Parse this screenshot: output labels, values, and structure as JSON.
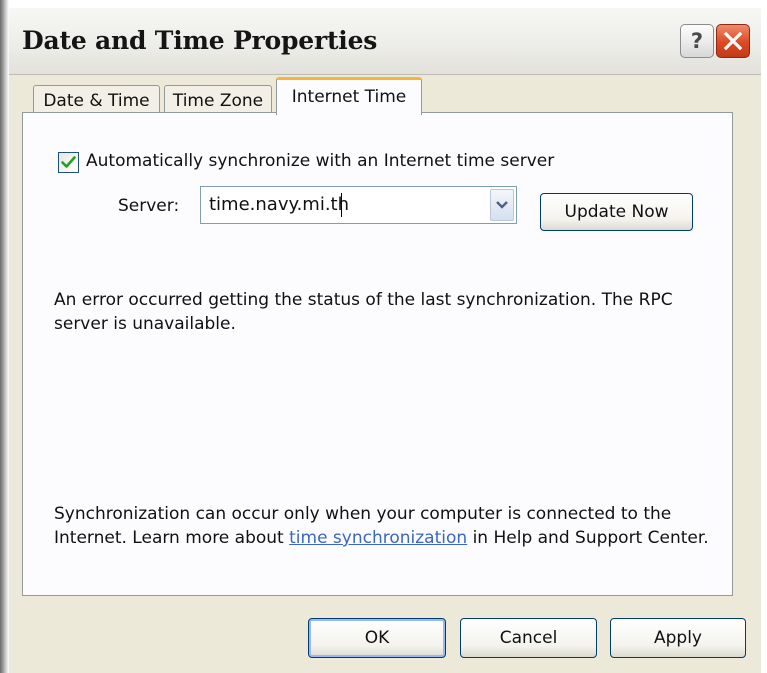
{
  "window": {
    "title": "Date and Time Properties",
    "help_glyph": "?",
    "help_icon": "question-mark-icon",
    "close_icon": "close-x-icon"
  },
  "tabs": [
    {
      "label": "Date & Time",
      "active": false
    },
    {
      "label": "Time Zone",
      "active": false
    },
    {
      "label": "Internet Time",
      "active": true
    }
  ],
  "sync": {
    "checkbox_label": "Automatically synchronize with an Internet time server",
    "checked": true,
    "server_label": "Server:",
    "server_value": "time.navy.mi.th",
    "update_button": "Update Now"
  },
  "status_message": "An error occurred getting the status of the last synchronization.  The RPC server is unavailable.",
  "info": {
    "text_before": "Synchronization can occur only when your computer is connected to the Internet.  Learn more about ",
    "link_text": "time synchronization",
    "text_after": " in Help and Support Center."
  },
  "buttons": {
    "ok": "OK",
    "cancel": "Cancel",
    "apply": "Apply"
  },
  "colors": {
    "dialog_bg": "#ECE9D8",
    "panel_bg": "#FCFCFE",
    "tab_active_accent": "#F7B43C",
    "close_red": "#DC4A24",
    "link_blue": "#3B66C6",
    "checkmark_green": "#21A121"
  }
}
